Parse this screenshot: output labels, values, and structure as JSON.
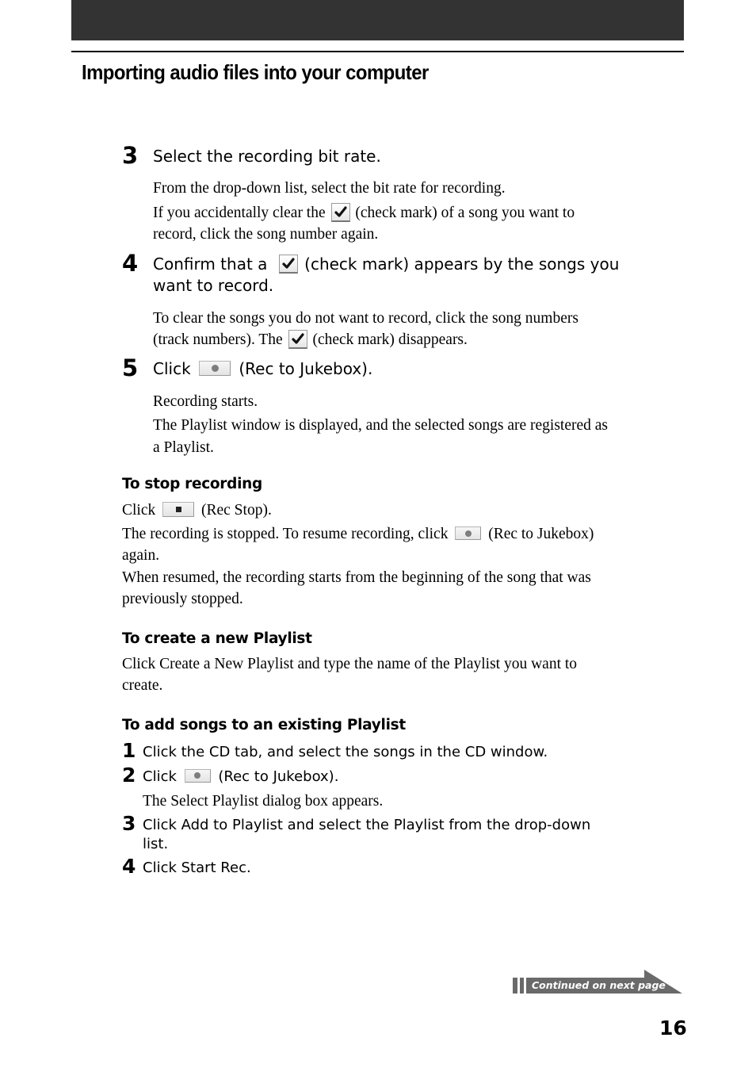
{
  "header": {
    "section_title": "Importing audio files into your computer"
  },
  "steps_main": [
    {
      "number": "3",
      "title": "Select the recording bit rate.",
      "body_line1": "From the drop-down list, select the bit rate for recording.",
      "body_line2_before": "If you accidentally clear the",
      "body_line2_after": "(check mark) of a song you want to",
      "body_line3": "record, click the song number again."
    },
    {
      "number": "4",
      "title_before": "Confirm that a",
      "title_after": "(check mark) appears by the songs you",
      "title_line2": "want to record.",
      "body_line1": "To clear the songs you do not want to record, click the song numbers",
      "body_line2_before": "(track numbers). The",
      "body_line2_after": "(check mark) disappears."
    },
    {
      "number": "5",
      "title_before": "Click",
      "title_after": "(Rec to Jukebox).",
      "body_line1": "Recording starts.",
      "body_line2": "The Playlist window is displayed, and the selected songs are registered as",
      "body_line3": "a Playlist."
    }
  ],
  "stop_recording": {
    "heading": "To stop recording",
    "line1_before": "Click",
    "line1_after": "(Rec Stop).",
    "line2_before": "The recording is stopped. To resume recording, click",
    "line2_after": "(Rec to Jukebox)",
    "line3": "again.",
    "line4": "When resumed, the recording starts from the beginning of the song that was",
    "line5": "previously stopped."
  },
  "new_playlist": {
    "heading": "To create a new Playlist",
    "line1": "Click Create a New Playlist and type the name of the Playlist you want to",
    "line2": "create."
  },
  "add_songs": {
    "heading": "To add songs to an existing Playlist",
    "steps": [
      {
        "number": "1",
        "text": "Click the CD tab, and select the songs in the CD window."
      },
      {
        "number": "2",
        "text_before": "Click",
        "text_after": "(Rec to Jukebox).",
        "note": "The Select Playlist dialog box appears."
      },
      {
        "number": "3",
        "text": "Click Add to Playlist and select the Playlist from the drop-down",
        "text_line2": "list."
      },
      {
        "number": "4",
        "text": "Click Start Rec."
      }
    ]
  },
  "icons": {
    "check": "check-mark-icon",
    "rec": "rec-to-jukebox-icon",
    "stop": "rec-stop-icon"
  },
  "footer": {
    "continued_label": "Continued on next page",
    "page_number": "16"
  },
  "colors": {
    "header_band": "#333333",
    "banner": "#6a6a6a"
  }
}
